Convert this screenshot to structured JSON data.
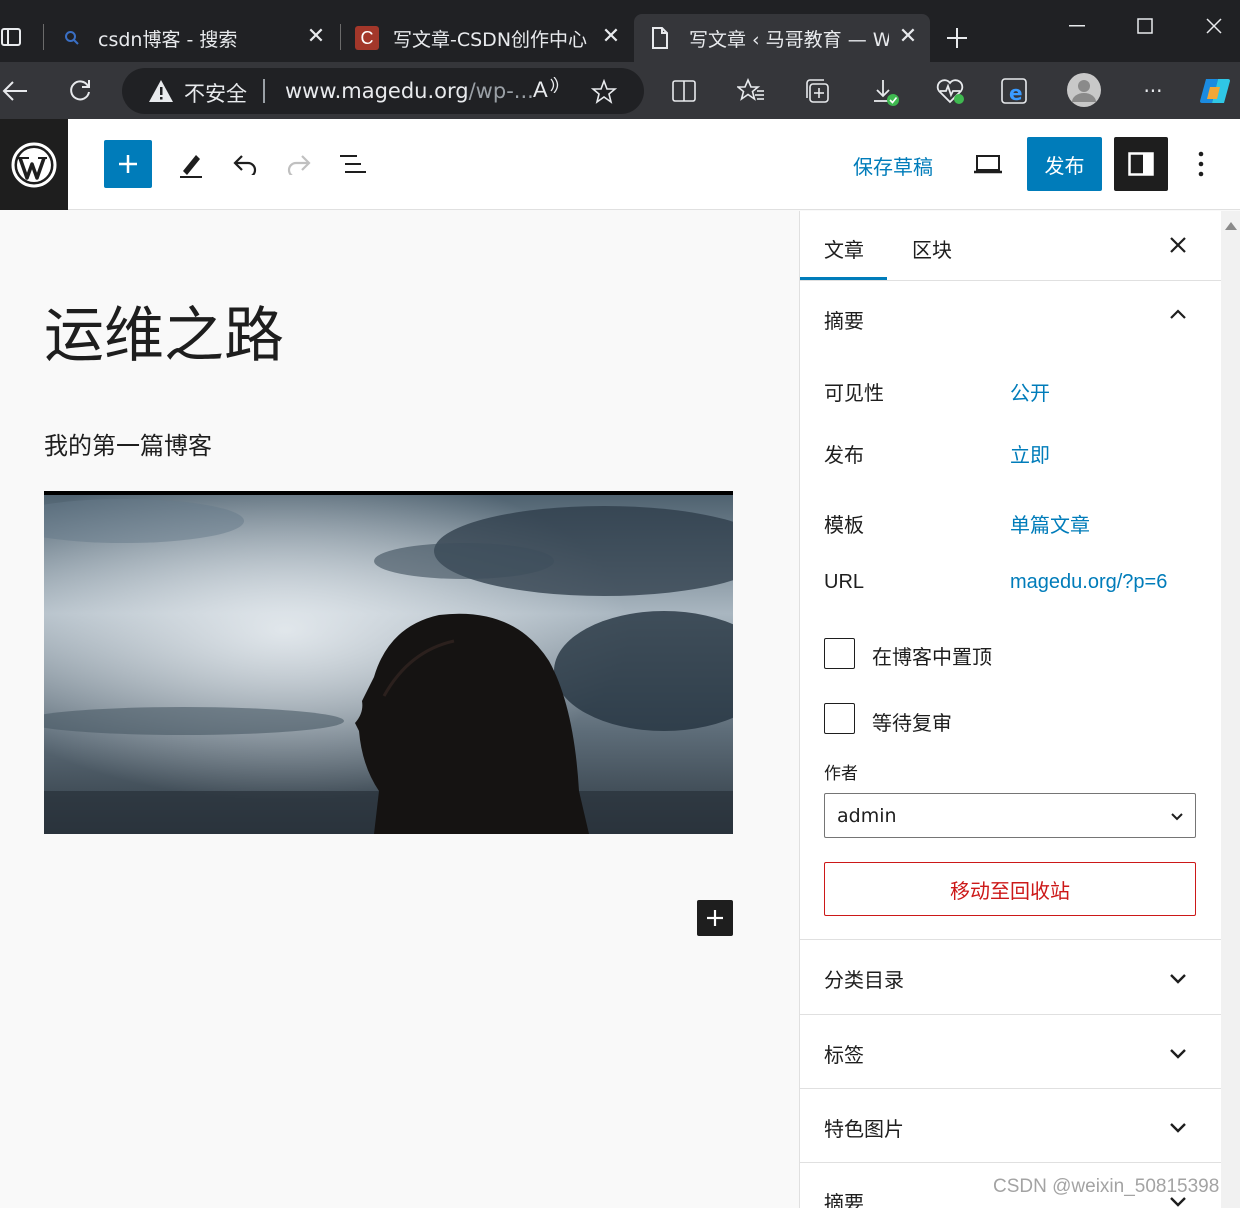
{
  "browser": {
    "tabs": [
      {
        "title": "csdn博客 - 搜索",
        "icon": "search-icon"
      },
      {
        "title": "写文章-CSDN创作中心",
        "icon": "csdn-icon"
      },
      {
        "title": "写文章 ‹ 马哥教育 — Wo",
        "icon": "page-icon"
      }
    ],
    "insecure_label": "不安全",
    "url_main": "www.magedu.org",
    "url_rest": "/wp-...",
    "read_aloud_label": "A",
    "menu_label": "···"
  },
  "wp_toolbar": {
    "save_draft": "保存草稿",
    "publish": "发布"
  },
  "post": {
    "title": "运维之路",
    "paragraph": "我的第一篇博客",
    "image_description": "featured image: silhouette of a woman against a cloudy sky"
  },
  "sidebar": {
    "tabs": {
      "post": "文章",
      "block": "区块"
    },
    "summary_title": "摘要",
    "rows": [
      {
        "label": "可见性",
        "value": "公开"
      },
      {
        "label": "发布",
        "value": "立即"
      },
      {
        "label": "模板",
        "value": "单篇文章"
      },
      {
        "label": "URL",
        "value": "magedu.org/?p=6"
      }
    ],
    "sticky_label": "在博客中置顶",
    "pending_label": "等待复审",
    "author_label": "作者",
    "author_value": "admin",
    "trash_label": "移动至回收站",
    "panels": [
      {
        "title": "分类目录"
      },
      {
        "title": "标签"
      },
      {
        "title": "特色图片"
      },
      {
        "title": "摘要"
      }
    ]
  },
  "watermark": "CSDN @weixin_50815398",
  "colors": {
    "accent": "#007cba",
    "trash": "#cc1818",
    "dark": "#1e1e1e"
  }
}
